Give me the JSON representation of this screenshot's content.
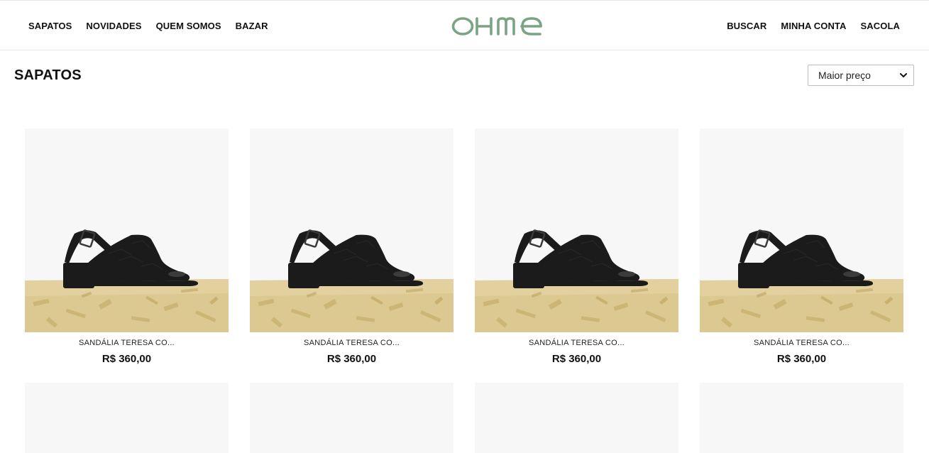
{
  "nav": {
    "left": [
      "SAPATOS",
      "NOVIDADES",
      "QUEM SOMOS",
      "BAZAR"
    ],
    "right": [
      "BUSCAR",
      "MINHA CONTA",
      "SACOLA"
    ]
  },
  "brand": {
    "logo_text": "OHMe",
    "color": "#7aa484"
  },
  "page": {
    "title": "SAPATOS"
  },
  "sort": {
    "selected": "Maior preço"
  },
  "products": [
    {
      "name": "SANDÁLIA TERESA CO...",
      "price": "R$ 360,00"
    },
    {
      "name": "SANDÁLIA TERESA CO...",
      "price": "R$ 360,00"
    },
    {
      "name": "SANDÁLIA TERESA CO...",
      "price": "R$ 360,00"
    },
    {
      "name": "SANDÁLIA TERESA CO...",
      "price": "R$ 360,00"
    }
  ],
  "colors": {
    "image_bg": "#f7f7f7",
    "wood": "#dcc891",
    "shoe": "#1b1b1b"
  }
}
